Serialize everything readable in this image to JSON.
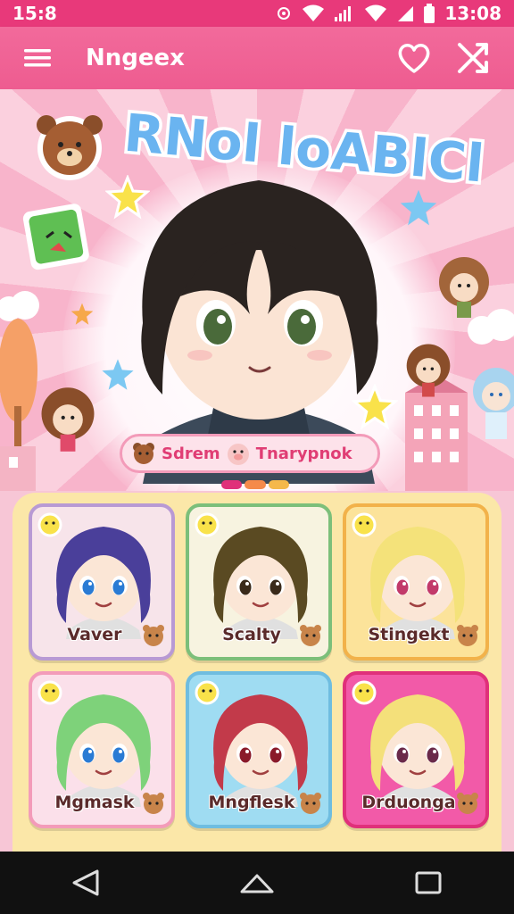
{
  "status_bar": {
    "time_left": "15:8",
    "time_right": "13:08"
  },
  "app_bar": {
    "title": "Nngeex"
  },
  "banner": {
    "title": "RNol loABlCl"
  },
  "tag_pill": {
    "left_label": "Sdrem",
    "right_label": "Tnarypnok"
  },
  "cards": [
    {
      "name": "Vaver",
      "bg": "#f7e4ea",
      "border": "#b89ad4",
      "hair": "#4a3f9a",
      "eyes": "#2a7bd4"
    },
    {
      "name": "Scalty",
      "bg": "#f7f3e0",
      "border": "#7cbf7a",
      "hair": "#5a4a22",
      "eyes": "#3a2a1a"
    },
    {
      "name": "Stingekt",
      "bg": "#fce39a",
      "border": "#f2b24a",
      "hair": "#f4e27a",
      "eyes": "#c23a6a"
    },
    {
      "name": "Mgmask",
      "bg": "#fbe0ea",
      "border": "#f39bb9",
      "hair": "#7ed27a",
      "eyes": "#2a7bd4"
    },
    {
      "name": "Mngflesk",
      "bg": "#9fdcf2",
      "border": "#6fbde0",
      "hair": "#c23a4a",
      "eyes": "#8a1a2a"
    },
    {
      "name": "Drduonga",
      "bg": "#f25aa8",
      "border": "#e0307a",
      "hair": "#f4e07a",
      "eyes": "#6a2a4a"
    }
  ],
  "colors": {
    "accent": "#ee5c90",
    "status": "#e8397a",
    "panel": "#fbe7a8"
  },
  "icons": [
    "menu-icon",
    "heart-icon",
    "shuffle-icon",
    "back-icon",
    "home-icon",
    "recents-icon"
  ]
}
